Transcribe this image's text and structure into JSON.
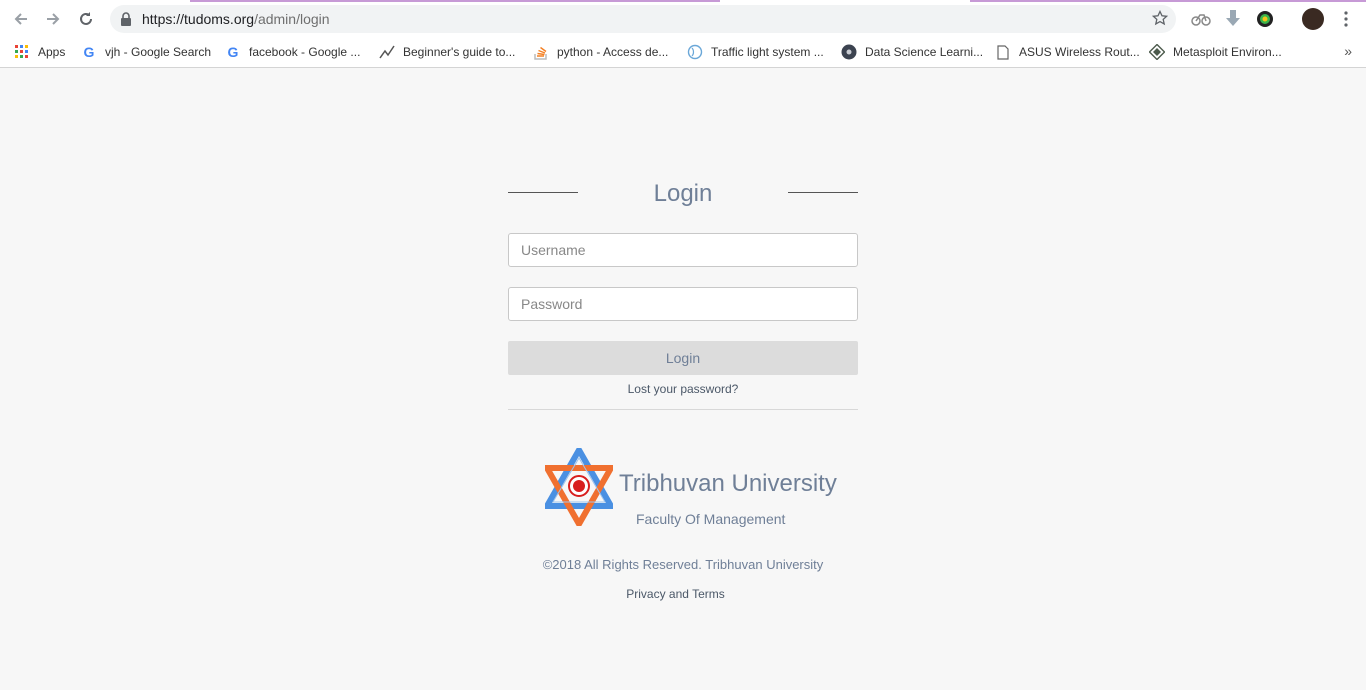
{
  "browser": {
    "url_host": "https://tudoms.org",
    "url_path": "/admin/login",
    "bookmarks": [
      {
        "label": "Apps",
        "icon": "apps-grid-icon"
      },
      {
        "label": "vjh - Google Search",
        "icon": "google-icon"
      },
      {
        "label": "facebook - Google ...",
        "icon": "google-icon"
      },
      {
        "label": "Beginner's guide to...",
        "icon": "chart-line-icon"
      },
      {
        "label": "python - Access de...",
        "icon": "stackoverflow-icon"
      },
      {
        "label": "Traffic light system ...",
        "icon": "globe-icon"
      },
      {
        "label": "Data Science Learni...",
        "icon": "circle-logo-icon"
      },
      {
        "label": "ASUS Wireless Rout...",
        "icon": "page-icon"
      },
      {
        "label": "Metasploit Environ...",
        "icon": "diamond-logo-icon"
      }
    ],
    "more_label": "»"
  },
  "login": {
    "title": "Login",
    "username_placeholder": "Username",
    "password_placeholder": "Password",
    "button_label": "Login",
    "lost_password": "Lost your password?"
  },
  "footer": {
    "university": "Tribhuvan University",
    "faculty": "Faculty Of Management",
    "copyright": "©2018 All Rights Reserved. Tribhuvan University",
    "privacy": "Privacy and Terms"
  },
  "colors": {
    "accent_text": "#6f7f97",
    "button_bg": "#dcdcdc",
    "logo_orange": "#f07030",
    "logo_blue": "#4a90e2",
    "logo_red": "#d81e1e"
  }
}
